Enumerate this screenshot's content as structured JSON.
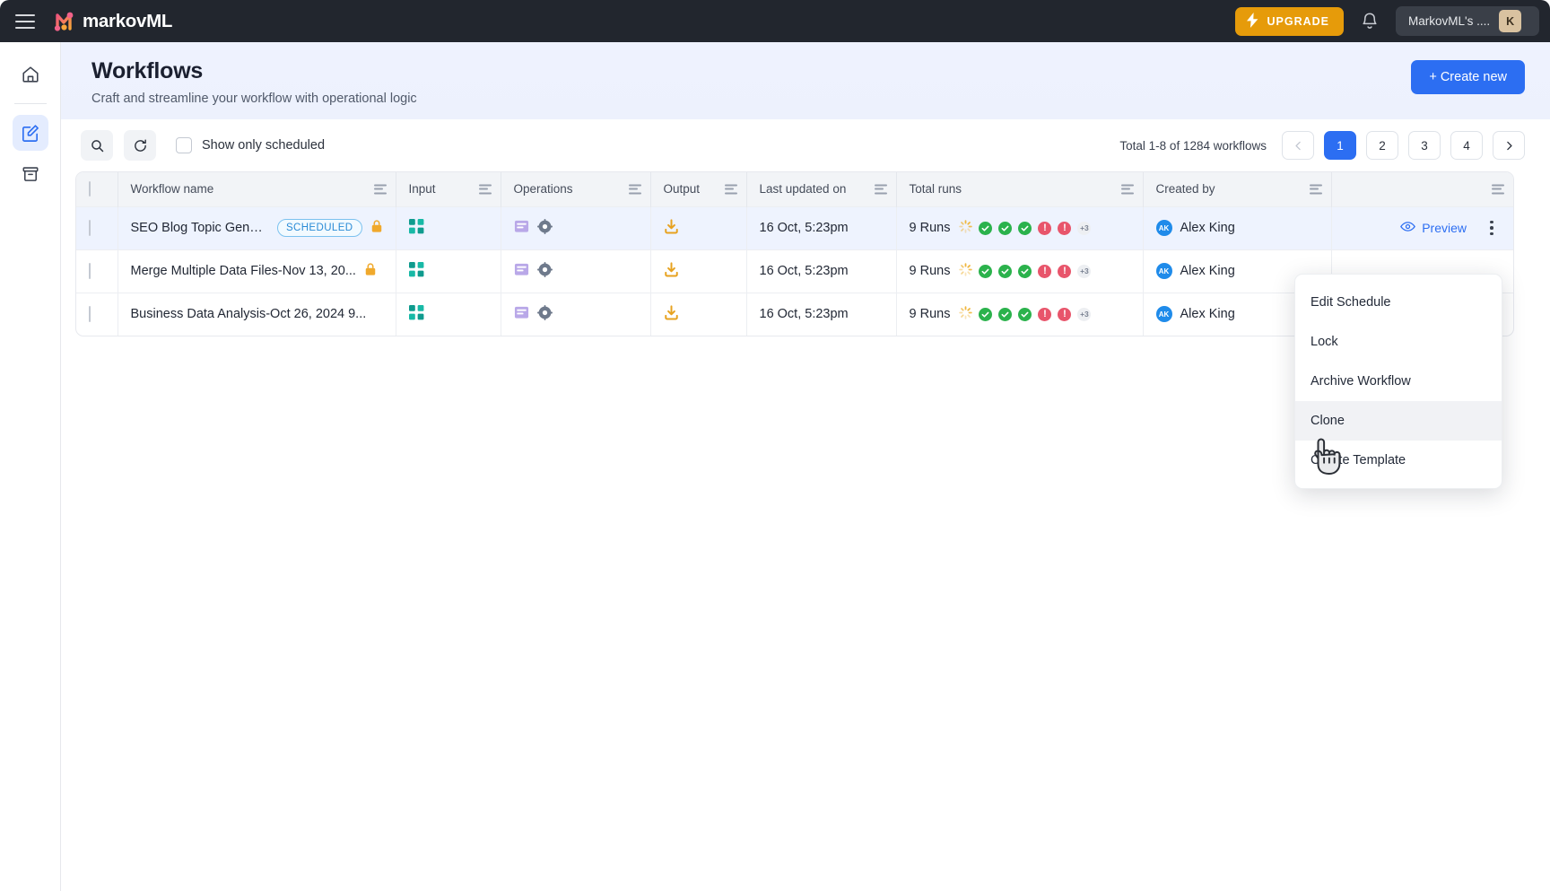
{
  "topbar": {
    "menu_icon": "hamburger-icon",
    "brand": "markovML",
    "upgrade_label": "UPGRADE",
    "upgrade_icon": "bolt-icon",
    "notification_icon": "bell-icon",
    "user_name": "MarkovML's ....",
    "user_initial": "K",
    "bg_color": "#22262e",
    "upgrade_color": "#e69b0a"
  },
  "rail": {
    "items": [
      {
        "name": "home",
        "icon": "home-icon",
        "active": false
      },
      {
        "name": "workflows",
        "icon": "edit-square-icon",
        "active": true
      },
      {
        "name": "archive",
        "icon": "archive-box-icon",
        "active": false
      }
    ],
    "active_color": "#2c6ef2"
  },
  "header": {
    "title": "Workflows",
    "subtitle": "Craft and streamline your workflow with operational logic",
    "create_label": "+ Create new",
    "create_color": "#2c6ef2"
  },
  "toolbar": {
    "search_icon": "search-icon",
    "refresh_icon": "refresh-icon",
    "checkbox_label": "Show only scheduled",
    "checkbox_checked": false,
    "total_text": "Total  1-8 of 1284 workflows",
    "pagination": {
      "prev_icon": "chevron-left-icon",
      "next_icon": "chevron-right-icon",
      "pages": [
        "1",
        "2",
        "3",
        "4"
      ],
      "current": "1"
    }
  },
  "table": {
    "columns": [
      {
        "label": "",
        "key": "checkbox"
      },
      {
        "label": "Workflow name",
        "key": "name"
      },
      {
        "label": "Input",
        "key": "input"
      },
      {
        "label": "Operations",
        "key": "operations"
      },
      {
        "label": "Output",
        "key": "output"
      },
      {
        "label": "Last updated on",
        "key": "updated"
      },
      {
        "label": "Total runs",
        "key": "runs"
      },
      {
        "label": "Created by",
        "key": "creator"
      },
      {
        "label": "",
        "key": "actions"
      }
    ],
    "rows": [
      {
        "name": "SEO Blog Topic Genera...",
        "badge": "SCHEDULED",
        "locked": true,
        "input_icon": "grid-squares-icon",
        "operations_icons": [
          "note-icon",
          "gear-icon"
        ],
        "output_icon": "download-icon",
        "updated": "16 Oct, 5:23pm",
        "runs_text": "9 Runs",
        "statuses": [
          "running",
          "success",
          "success",
          "success",
          "error",
          "error"
        ],
        "more_runs": "+3",
        "creator": "Alex King",
        "creator_initials": "AK",
        "preview_label": "Preview",
        "preview_icon": "eye-icon",
        "selected": true
      },
      {
        "name": "Merge Multiple Data Files-Nov 13, 20...",
        "badge": "",
        "locked": true,
        "input_icon": "grid-squares-icon",
        "operations_icons": [
          "note-icon",
          "gear-icon"
        ],
        "output_icon": "download-icon",
        "updated": "16 Oct, 5:23pm",
        "runs_text": "9 Runs",
        "statuses": [
          "running",
          "success",
          "success",
          "success",
          "error",
          "error"
        ],
        "more_runs": "+3",
        "creator": "Alex King",
        "creator_initials": "AK",
        "preview_label": "",
        "preview_icon": "eye-icon",
        "selected": false
      },
      {
        "name": "Business Data Analysis-Oct 26, 2024 9...",
        "badge": "",
        "locked": false,
        "input_icon": "grid-squares-icon",
        "operations_icons": [
          "note-icon",
          "gear-icon"
        ],
        "output_icon": "download-icon",
        "updated": "16 Oct, 5:23pm",
        "runs_text": "9 Runs",
        "statuses": [
          "running",
          "success",
          "success",
          "success",
          "error",
          "error"
        ],
        "more_runs": "+3",
        "creator": "Alex King",
        "creator_initials": "AK",
        "preview_label": "",
        "preview_icon": "eye-icon",
        "selected": false
      }
    ]
  },
  "context_menu": {
    "items": [
      {
        "label": "Edit Schedule",
        "highlighted": false
      },
      {
        "label": "Lock",
        "highlighted": false
      },
      {
        "label": "Archive Workflow",
        "highlighted": false
      },
      {
        "label": "Clone",
        "highlighted": true
      },
      {
        "label": "Create Template",
        "highlighted": false
      }
    ]
  },
  "cursor": {
    "icon": "pointing-hand-cursor"
  }
}
